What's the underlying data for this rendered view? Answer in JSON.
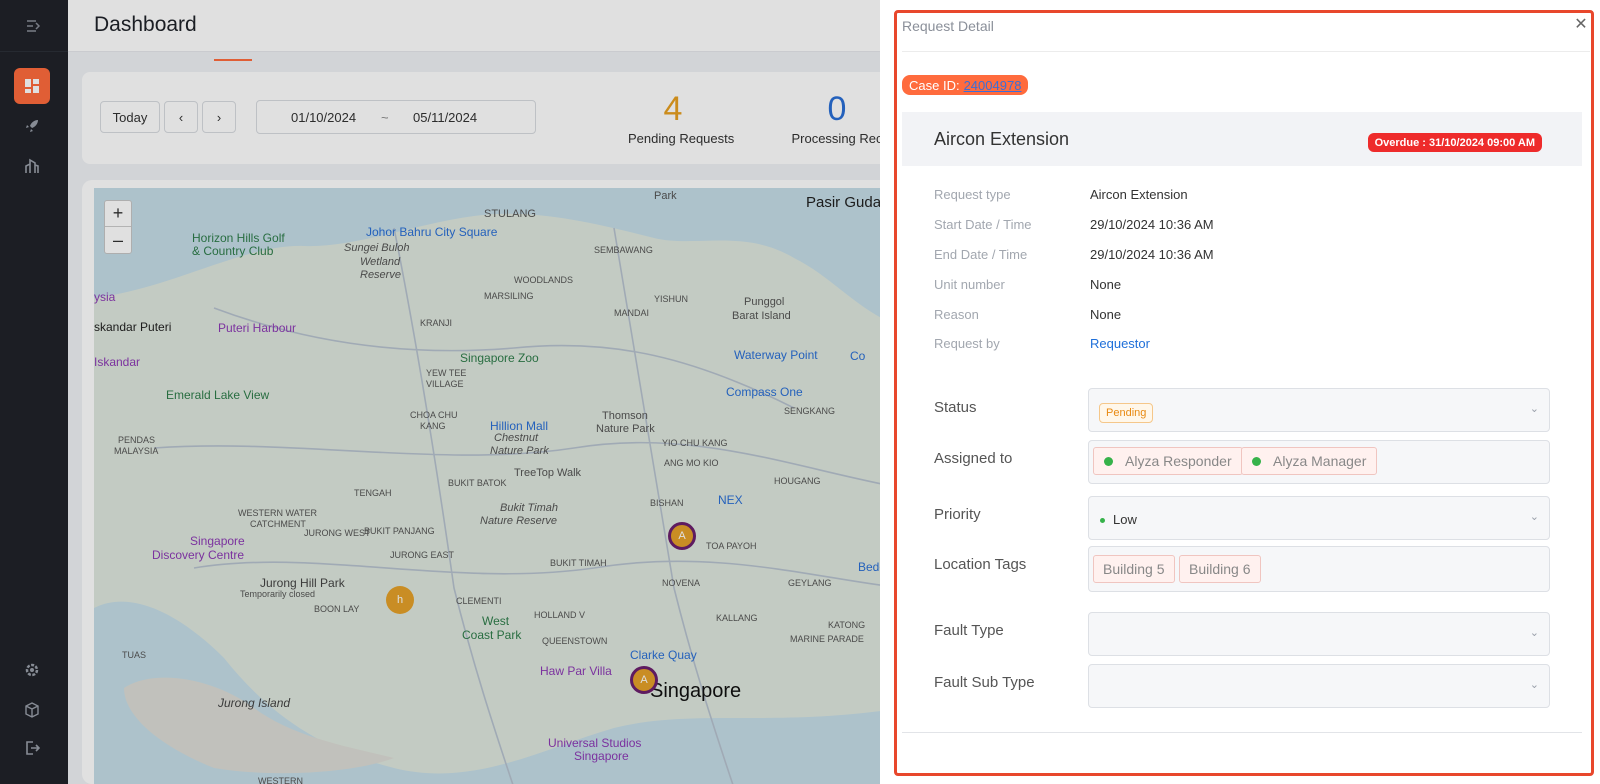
{
  "header": {
    "title": "Dashboard"
  },
  "sidebar": {
    "top_icon": "collapse-icon",
    "items": [
      {
        "name": "dashboard",
        "icon": "dashboard-icon"
      },
      {
        "name": "launch",
        "icon": "rocket-icon"
      },
      {
        "name": "reports",
        "icon": "building-icon"
      },
      {
        "name": "settings",
        "icon": "gear-icon"
      },
      {
        "name": "packages",
        "icon": "cube-icon"
      },
      {
        "name": "logout",
        "icon": "logout-icon"
      }
    ]
  },
  "filters": {
    "today_label": "Today",
    "start_date": "01/10/2024",
    "separator": "~",
    "end_date": "05/11/2024"
  },
  "stats": [
    {
      "value": "4",
      "label": "Pending Requests",
      "color": "#e8a020"
    },
    {
      "value": "0",
      "label": "Processing Rec",
      "color": "#2a6fd6"
    }
  ],
  "map": {
    "labels": {
      "horizon": "Horizon Hills Golf",
      "country_club": "& Country Club",
      "johor": "Johor Bahru City Square",
      "stulang": "STULANG",
      "park": "Park",
      "pasir": "Pasir Guda",
      "sungei1": "Sungei Buloh",
      "sungei2": "Wetland",
      "sungei3": "Reserve",
      "sembawang": "SEMBAWANG",
      "woodlands": "WOODLANDS",
      "marsiling": "MARSILING",
      "yishun": "YISHUN",
      "punggol1": "Punggol",
      "punggol2": "Barat Island",
      "ysia": "ysia",
      "iskandar_puteri": "skandar Puteri",
      "puteri_harbour": "Puteri Harbour",
      "kranji": "KRANJI",
      "mandai": "MANDAI",
      "iskandar": "Iskandar",
      "singapore_zoo": "Singapore Zoo",
      "waterway": "Waterway Point",
      "co": "Co",
      "yew_tee1": "YEW TEE",
      "yew_tee2": "VILLAGE",
      "emerald": "Emerald Lake View",
      "compass": "Compass One",
      "sengkang": "SENGKANG",
      "choa_chu1": "CHOA CHU",
      "choa_chu2": "KANG",
      "hillion": "Hillion Mall",
      "thomson1": "Thomson",
      "thomson2": "Nature Park",
      "pendas1": "PENDAS",
      "pendas2": "MALAYSIA",
      "chestnut1": "Chestnut",
      "chestnut2": "Nature Park",
      "yio_chu": "YIO CHU KANG",
      "treetop": "TreeTop Walk",
      "ang_mo": "ANG MO KIO",
      "tengah": "TENGAH",
      "bukit_batok": "BUKIT BATOK",
      "nex": "NEX",
      "hougang": "HOUGANG",
      "bukit_timah1": "Bukit Timah",
      "bukit_timah2": "Nature Reserve",
      "bishan": "BISHAN",
      "western1": "WESTERN WATER",
      "western2": "CATCHMENT",
      "jurong_west": "JURONG WEST",
      "bukit_panjang": "BUKIT PANJANG",
      "toa_payoh": "TOA PAYOH",
      "sg_disc1": "Singapore",
      "sg_disc2": "Discovery Centre",
      "jurong_east": "JURONG EAST",
      "bedok": "Bedok",
      "bukit_timah_town": "BUKIT TIMAH",
      "jurong_hill": "Jurong Hill Park",
      "temp_closed": "Temporarily closed",
      "novena": "NOVENA",
      "geylang": "GEYLANG",
      "boon_lay": "BOON LAY",
      "clementi": "CLEMENTI",
      "holland": "HOLLAND V",
      "kallang": "KALLANG",
      "west1": "West",
      "west2": "Coast Park",
      "queenstown": "QUEENSTOWN",
      "marine": "MARINE PARADE",
      "katong": "KATONG",
      "tuas": "TUAS",
      "clarke": "Clarke Quay",
      "haw_par": "Haw Par Villa",
      "singapore": "Singapore",
      "jurong_island": "Jurong Island",
      "universal1": "Universal Studios",
      "universal2": "Singapore",
      "western_bottom": "WESTERN"
    },
    "markers": [
      {
        "label": "A"
      },
      {
        "label": "h"
      },
      {
        "label": "A"
      }
    ]
  },
  "drawer": {
    "title": "Request Detail",
    "case_prefix": "Case ID:",
    "case_id": "24004978",
    "request_title": "Aircon Extension",
    "overdue": "Overdue : 31/10/2024 09:00 AM",
    "info": [
      {
        "key": "Request type",
        "value": "Aircon Extension"
      },
      {
        "key": "Start Date / Time",
        "value": "29/10/2024 10:36 AM"
      },
      {
        "key": "End Date / Time",
        "value": "29/10/2024 10:36 AM"
      },
      {
        "key": "Unit number",
        "value": "None"
      },
      {
        "key": "Reason",
        "value": "None"
      },
      {
        "key": "Request by",
        "value": "Requestor"
      }
    ],
    "form": {
      "status_label": "Status",
      "status_value": "Pending",
      "assigned_label": "Assigned to",
      "assignees": [
        "Alyza Responder",
        "Alyza Manager"
      ],
      "priority_label": "Priority",
      "priority_value": "Low",
      "location_label": "Location Tags",
      "locations": [
        "Building 5",
        "Building 6"
      ],
      "fault_type_label": "Fault Type",
      "fault_sub_type_label": "Fault Sub Type"
    },
    "colors": {
      "accent": "#ff6b3d",
      "overdue": "#ee2b2b",
      "frame": "#e8472c"
    }
  }
}
